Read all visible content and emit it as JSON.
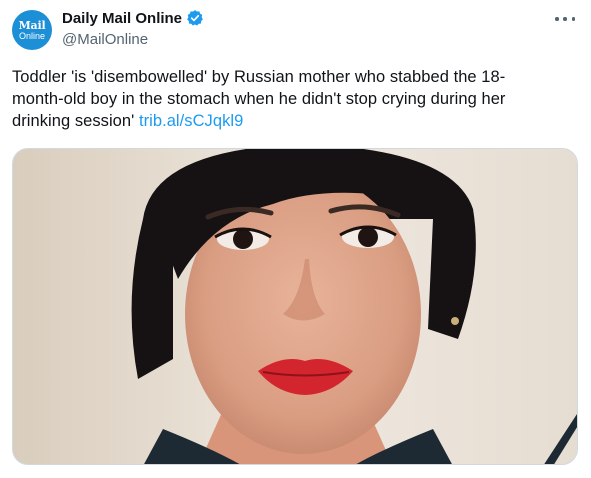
{
  "account": {
    "avatar_line1": "Mail",
    "avatar_line2": "Online",
    "display_name": "Daily Mail Online",
    "handle": "@MailOnline",
    "verified": true
  },
  "icons": {
    "verified": "verified-badge-icon",
    "more": "more-options-icon"
  },
  "tweet": {
    "text": "Toddler 'is 'disembowelled' by Russian mother who stabbed the 18-month-old boy in the stomach when he didn't stop crying during her drinking session'",
    "text_line1": "Toddler 'is 'disembowelled' by Russian mother who stabbed the 18-",
    "text_line2": "month-old boy in the stomach when he didn't stop crying during her",
    "text_line3": "drinking session'",
    "link": "trib.al/sCJqkl9"
  },
  "colors": {
    "link": "#1d9bf0",
    "verified": "#1d9bf0",
    "brand": "#1d8fd6",
    "secondary_text": "#536471"
  }
}
